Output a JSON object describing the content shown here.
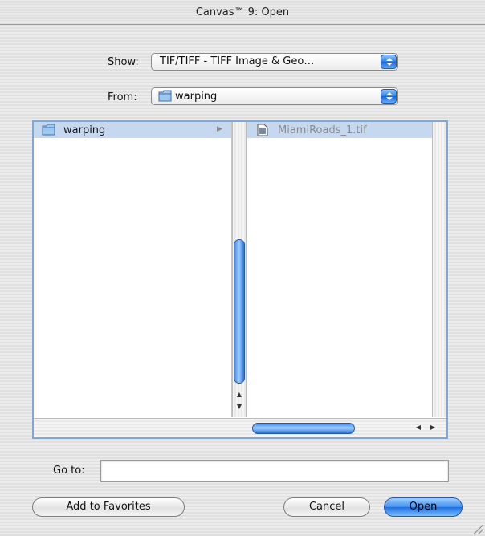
{
  "window": {
    "title": "Canvas™ 9: Open"
  },
  "show": {
    "label": "Show:",
    "value": "TIF/TIFF - TIFF Image & Geo…"
  },
  "from": {
    "label": "From:",
    "value": "warping"
  },
  "browser": {
    "column1": [
      {
        "label": "warping",
        "icon": "folder-icon",
        "selected": true
      }
    ],
    "column2": [
      {
        "label": "MiamiRoads_1.tif",
        "icon": "tiff-file-icon",
        "selected": true
      }
    ]
  },
  "goto": {
    "label": "Go to:",
    "value": ""
  },
  "buttons": {
    "add_favorites": "Add to Favorites",
    "cancel": "Cancel",
    "open": "Open"
  },
  "colors": {
    "accent": "#2a7fe6",
    "selection": "#c5d8f0"
  }
}
